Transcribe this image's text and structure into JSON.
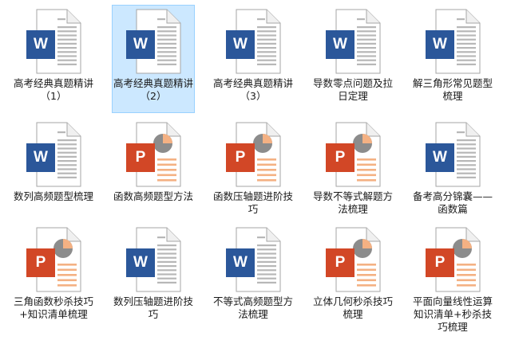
{
  "files": [
    {
      "label": "高考经典真题精讲（1）",
      "type": "word",
      "selected": false
    },
    {
      "label": "高考经典真题精讲（2）",
      "type": "word",
      "selected": true
    },
    {
      "label": "高考经典真题精讲（3）",
      "type": "word",
      "selected": false
    },
    {
      "label": "导数零点问题及拉日定理",
      "type": "word",
      "selected": false
    },
    {
      "label": "解三角形常见题型梳理",
      "type": "word",
      "selected": false
    },
    {
      "label": "数列高频题型梳理",
      "type": "word",
      "selected": false
    },
    {
      "label": "函数高频题型方法",
      "type": "ppt",
      "selected": false
    },
    {
      "label": "函数压轴题进阶技巧",
      "type": "ppt",
      "selected": false
    },
    {
      "label": "导数不等式解题方法梳理",
      "type": "ppt",
      "selected": false
    },
    {
      "label": "备考高分锦囊——函数篇",
      "type": "word",
      "selected": false
    },
    {
      "label": "三角函数秒杀技巧+知识清单梳理",
      "type": "ppt",
      "selected": false
    },
    {
      "label": "数列压轴题进阶技巧",
      "type": "word",
      "selected": false
    },
    {
      "label": "不等式高频题型方法梳理",
      "type": "word",
      "selected": false
    },
    {
      "label": "立体几何秒杀技巧梳理",
      "type": "ppt",
      "selected": false
    },
    {
      "label": "平面向量线性运算知识清单+秒杀技巧梳理",
      "type": "ppt",
      "selected": false
    }
  ],
  "icons": {
    "word": {
      "letter": "W",
      "color": "#2b579a",
      "name": "word-document-icon"
    },
    "ppt": {
      "letter": "P",
      "color": "#d24726",
      "name": "powerpoint-document-icon"
    }
  },
  "colors": {
    "selection_bg": "#cce8ff",
    "selection_border": "#99d1ff",
    "ppt_accent": "#f4b183",
    "pie_gray": "#8c8c8c"
  }
}
